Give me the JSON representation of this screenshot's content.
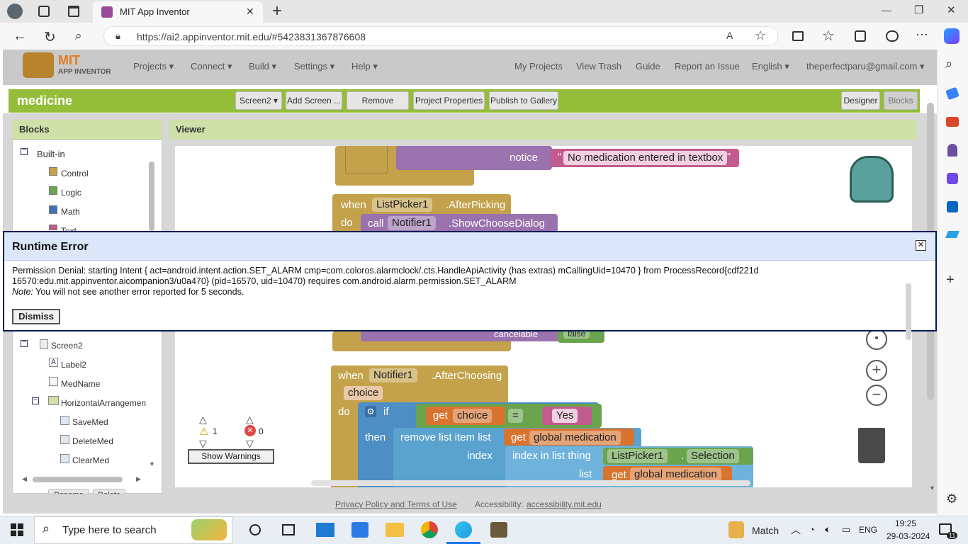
{
  "browser": {
    "tab_title": "MIT App Inventor",
    "url": "https://ai2.appinventor.mit.edu/#5423831367876608",
    "new_tab": "+",
    "close_tab": "✕",
    "win_min": "—",
    "win_max": "❐",
    "win_close": "✕"
  },
  "ai": {
    "logo_line1": "MIT",
    "logo_line2": "APP INVENTOR",
    "menu": [
      "Projects ▾",
      "Connect ▾",
      "Build ▾",
      "Settings ▾",
      "Help ▾"
    ],
    "right_menu": [
      "My Projects",
      "View Trash",
      "Guide",
      "Report an Issue",
      "English ▾",
      "theperfectparu@gmail.com ▾"
    ],
    "project_name": "medicine",
    "toolbar": [
      "Screen2 ▾",
      "Add Screen ...",
      "Remove Screen",
      "Project Properties",
      "Publish to Gallery"
    ],
    "mode_designer": "Designer",
    "mode_blocks": "Blocks",
    "blocks_panel_title": "Blocks",
    "viewer_title": "Viewer",
    "tree_builtin": "Built-in",
    "tree_items": [
      "Control",
      "Logic",
      "Math",
      "Text"
    ],
    "tree_screen": "Screen2",
    "tree_components": [
      "Label2",
      "MedName",
      "HorizontalArrangemen",
      "SaveMed",
      "DeleteMed",
      "ClearMed"
    ],
    "bottom_buttons": [
      "Rename",
      "Delete"
    ],
    "warn_count": "1",
    "error_count": "0",
    "show_warnings": "Show Warnings",
    "footer_privacy": "Privacy Policy and Terms of Use",
    "footer_access_label": "Accessibility:",
    "footer_access_link": "accessibility.mit.edu"
  },
  "blocks": {
    "notice": "notice",
    "notice_text": "No medication entered in textbox",
    "when1": "when",
    "listpicker": "ListPicker1",
    "after_picking": ".AfterPicking",
    "do1": "do",
    "call": "call",
    "notifier": "Notifier1",
    "show_choose": ".ShowChooseDialog",
    "cancelable": "cancelable",
    "false_val": "false",
    "when2": "when",
    "notifier2": "Notifier1",
    "after_choosing": ".AfterChoosing",
    "choice": "choice",
    "do2": "do",
    "if": "if",
    "get": "get",
    "choice2": "choice",
    "eq": "=",
    "yes": "Yes",
    "then": "then",
    "remove_list": "remove list item  list",
    "get2": "get",
    "global_med": "global medication",
    "index": "index",
    "index_in_list": "index in list  thing",
    "listpicker2": "ListPicker1",
    "selection": "Selection",
    "list": "list",
    "get3": "get",
    "global_med2": "global medication"
  },
  "dialog": {
    "title": "Runtime Error",
    "message_line1": "Permission Denial: starting Intent { act=android.intent.action.SET_ALARM cmp=com.coloros.alarmclock/.cts.HandleApiActivity (has extras) mCallingUid=10470 } from ProcessRecord{cdf221d",
    "message_line2": "16570:edu.mit.appinventor.aicompanion3/u0a470} (pid=16570, uid=10470) requires com.android.alarm.permission.SET_ALARM",
    "note_label": "Note:",
    "note_text": " You will not see another error reported for 5 seconds.",
    "dismiss": "Dismiss",
    "close": "✕"
  },
  "taskbar": {
    "search_placeholder": "Type here to search",
    "weather": "Match",
    "lang": "ENG",
    "time": "19:25",
    "date": "29-03-2024",
    "notif_count": "11"
  },
  "colors": {
    "ai_green": "#94bd3a",
    "dialog_border": "#001a55",
    "control": "#c4a24c",
    "logic": "#6aa44d",
    "math": "#3f71b5",
    "text": "#c25b8e"
  }
}
